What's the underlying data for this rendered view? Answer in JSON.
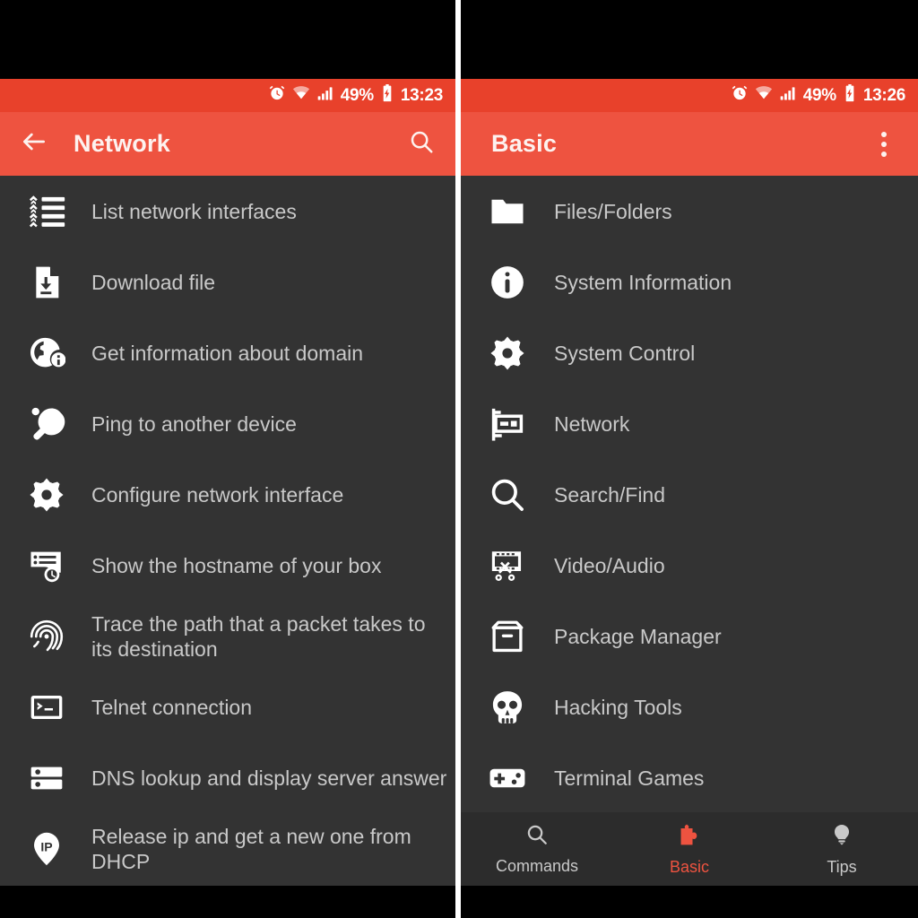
{
  "theme": {
    "status_bar_red": "#E8412B",
    "toolbar_red": "#EE5340",
    "list_background": "#333333",
    "bottom_nav_background": "#2C2C2C",
    "label_gray": "#C9C9C9",
    "accent_red": "#EE5340",
    "bezel_black": "#000000"
  },
  "left_screen": {
    "status_bar": {
      "alarm_icon": "alarm-clock-icon",
      "wifi_icon": "wifi-icon",
      "signal_icon": "cellular-signal-icon",
      "battery_percent": "49%",
      "battery_icon": "battery-charging-icon",
      "time": "13:23"
    },
    "toolbar": {
      "back_icon": "back-arrow-icon",
      "title": "Network",
      "action_icon": "search-icon"
    },
    "items": [
      {
        "icon": "list-network-interfaces-icon",
        "label": "List network interfaces"
      },
      {
        "icon": "download-file-icon",
        "label": "Download file"
      },
      {
        "icon": "globe-info-icon",
        "label": "Get information about domain"
      },
      {
        "icon": "ping-pong-paddle-icon",
        "label": "Ping to another device"
      },
      {
        "icon": "gear-icon",
        "label": "Configure network interface"
      },
      {
        "icon": "hostname-card-icon",
        "label": "Show the hostname of your box"
      },
      {
        "icon": "fingerprint-icon",
        "label": "Trace the path that a packet takes to its destination"
      },
      {
        "icon": "terminal-prompt-icon",
        "label": "Telnet connection"
      },
      {
        "icon": "server-rack-icon",
        "label": "DNS lookup and display server answer"
      },
      {
        "icon": "ip-pin-icon",
        "label": "Release ip and get a new one from DHCP"
      }
    ]
  },
  "right_screen": {
    "status_bar": {
      "alarm_icon": "alarm-clock-icon",
      "wifi_icon": "wifi-icon",
      "signal_icon": "cellular-signal-icon",
      "battery_percent": "49%",
      "battery_icon": "battery-charging-icon",
      "time": "13:26"
    },
    "toolbar": {
      "title": "Basic",
      "action_icon": "overflow-menu-icon"
    },
    "items": [
      {
        "icon": "folder-icon",
        "label": "Files/Folders"
      },
      {
        "icon": "info-circle-icon",
        "label": "System Information"
      },
      {
        "icon": "gear-icon",
        "label": "System Control"
      },
      {
        "icon": "network-card-icon",
        "label": "Network"
      },
      {
        "icon": "search-icon",
        "label": "Search/Find"
      },
      {
        "icon": "film-scissors-icon",
        "label": "Video/Audio"
      },
      {
        "icon": "package-box-icon",
        "label": "Package Manager"
      },
      {
        "icon": "skull-icon",
        "label": "Hacking Tools"
      },
      {
        "icon": "gamepad-icon",
        "label": "Terminal Games"
      }
    ],
    "bottom_nav": [
      {
        "icon": "search-icon",
        "label": "Commands",
        "active": false
      },
      {
        "icon": "puzzle-piece-icon",
        "label": "Basic",
        "active": true
      },
      {
        "icon": "lightbulb-icon",
        "label": "Tips",
        "active": false
      }
    ]
  }
}
